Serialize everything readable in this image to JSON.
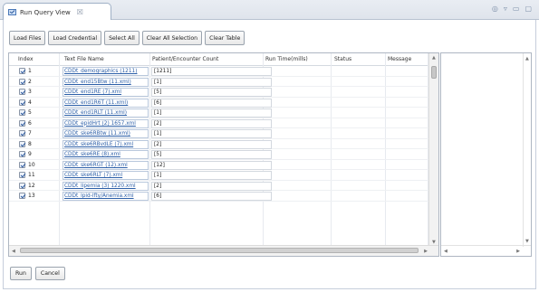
{
  "view": {
    "tab_title": "Run Query View",
    "tab_close": "☒",
    "actions": [
      "◎",
      "▿",
      "▭",
      "▢"
    ]
  },
  "toolbar": {
    "load_files": "Load Files",
    "load_credential": "Load Credential",
    "select_all": "Select All",
    "clear_all_selection": "Clear All Selection",
    "clear_table": "Clear Table"
  },
  "table": {
    "columns": [
      "Index",
      "Text File Name",
      "Patient/Encounter Count",
      "Run Time(mills)",
      "Status",
      "Message"
    ],
    "rows": [
      {
        "index": "1",
        "file": "CDDt_demographics (1211)",
        "count": "[1211]"
      },
      {
        "index": "2",
        "file": "CDDt_end15Btw (11.xml)",
        "count": "[1]"
      },
      {
        "index": "3",
        "file": "CDDt_end1RE (7).xml",
        "count": "[5]"
      },
      {
        "index": "4",
        "file": "CDDt_end1R6T (11.xml)",
        "count": "[6]"
      },
      {
        "index": "5",
        "file": "CDDt_end1RLT (11.xml)",
        "count": "[1]"
      },
      {
        "index": "6",
        "file": "CDDt_epidHrt (2) 1657.xml",
        "count": "[2]"
      },
      {
        "index": "7",
        "file": "CDDt_ske6RBtw (11.xml)",
        "count": "[1]"
      },
      {
        "index": "8",
        "file": "CDDt_ske6RBvdLE (7).xml",
        "count": "[2]"
      },
      {
        "index": "9",
        "file": "CDDt_ske6RE (8).xml",
        "count": "[5]"
      },
      {
        "index": "10",
        "file": "CDDt_ske6RGT (12).xml",
        "count": "[12]"
      },
      {
        "index": "11",
        "file": "CDDt_ske6RLT (7).xml",
        "count": "[1]"
      },
      {
        "index": "12",
        "file": "CDDt_lipemia (3) 1220.xml",
        "count": "[2]"
      },
      {
        "index": "13",
        "file": "CDDt_lpid-lfty/Anemia.xml",
        "count": "[6]"
      }
    ]
  },
  "footer": {
    "run": "Run",
    "cancel": "Cancel"
  }
}
